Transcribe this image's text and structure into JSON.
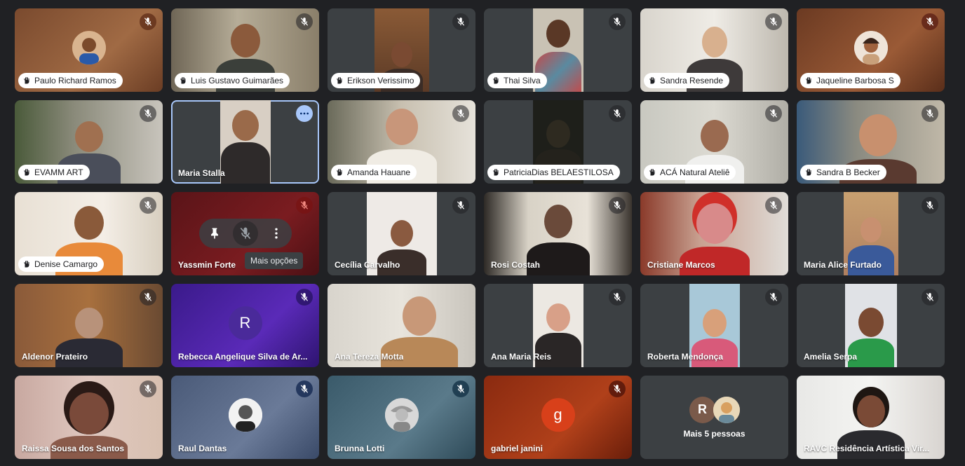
{
  "tooltip": "Mais opções",
  "more_people_label": "Mais 5 pessoas",
  "more_people_initial": "R",
  "tiles": [
    {
      "name": "Paulo Richard Ramos",
      "pill": true
    },
    {
      "name": "Luis Gustavo Guimarães",
      "pill": true
    },
    {
      "name": "Erikson Verissimo",
      "pill": true
    },
    {
      "name": "Thai Silva",
      "pill": true
    },
    {
      "name": "Sandra Resende",
      "pill": true
    },
    {
      "name": "Jaqueline Barbosa S",
      "pill": true
    },
    {
      "name": "EVAMM ART",
      "pill": true
    },
    {
      "name": "Maria Stalla",
      "pill": false
    },
    {
      "name": "Amanda Hauane",
      "pill": true
    },
    {
      "name": "PatriciaDias BELAESTILOSA",
      "pill": true
    },
    {
      "name": "ACÁ Natural Ateliê",
      "pill": true
    },
    {
      "name": "Sandra B Becker",
      "pill": true
    },
    {
      "name": "Denise Camargo",
      "pill": true
    },
    {
      "name": "Yassmin Forte",
      "pill": false
    },
    {
      "name": "Cecília Carvalho",
      "pill": false
    },
    {
      "name": "Rosi Costah",
      "pill": false
    },
    {
      "name": "Cristiane Marcos",
      "pill": false
    },
    {
      "name": "Maria Alice Furtado",
      "pill": false
    },
    {
      "name": "Aldenor Prateiro",
      "pill": false
    },
    {
      "name": "Rebecca Angelique Silva de Ar...",
      "pill": false,
      "initial": "R"
    },
    {
      "name": "Ana Tereza Motta",
      "pill": false
    },
    {
      "name": "Ana Maria Reis",
      "pill": false
    },
    {
      "name": "Roberta Mendonça",
      "pill": false
    },
    {
      "name": "Amelia Serpa",
      "pill": false
    },
    {
      "name": "Raissa Sousa dos Santos",
      "pill": false
    },
    {
      "name": "Raul Dantas",
      "pill": false
    },
    {
      "name": "Brunna Lotti",
      "pill": false
    },
    {
      "name": "gabriel janini",
      "pill": false,
      "initial": "g"
    },
    {
      "name": "",
      "pill": false
    },
    {
      "name": "RAVC Residência Artística Vir...",
      "pill": false
    }
  ],
  "colors": {
    "background": "#202124",
    "tile": "#3c4043",
    "selected_outline": "#a8c7fa",
    "muted_red": "#ea4335"
  }
}
